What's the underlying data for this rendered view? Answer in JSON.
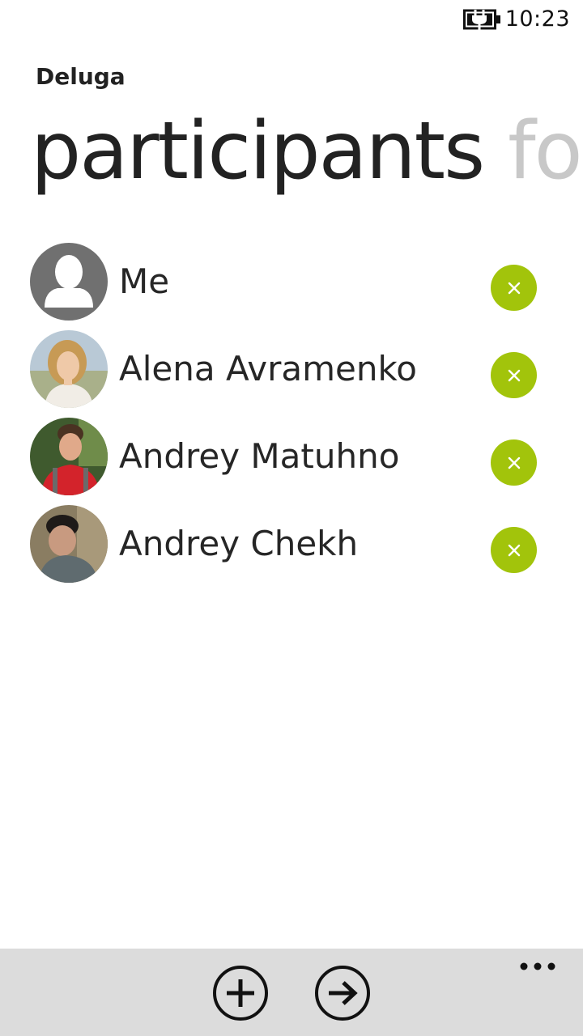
{
  "status_bar": {
    "time": "10:23",
    "battery_icon": "battery-charging-icon"
  },
  "app": {
    "title": "Deluga"
  },
  "pivot": {
    "active": "participants",
    "next_peek": "fo"
  },
  "participants": [
    {
      "name": "Me",
      "avatar": "default-person-icon"
    },
    {
      "name": "Alena Avramenko",
      "avatar": "photo"
    },
    {
      "name": "Andrey Matuhno",
      "avatar": "photo"
    },
    {
      "name": "Andrey Chekh",
      "avatar": "photo"
    }
  ],
  "remove_icon": "close-icon",
  "app_bar": {
    "buttons": [
      {
        "icon": "add-icon"
      },
      {
        "icon": "next-arrow-icon"
      }
    ],
    "more_icon": "more-dots-icon"
  },
  "colors": {
    "accent": "#a2c40b",
    "app_bar_bg": "#dcdcdc",
    "pivot_inactive": "#c8c8c8"
  }
}
